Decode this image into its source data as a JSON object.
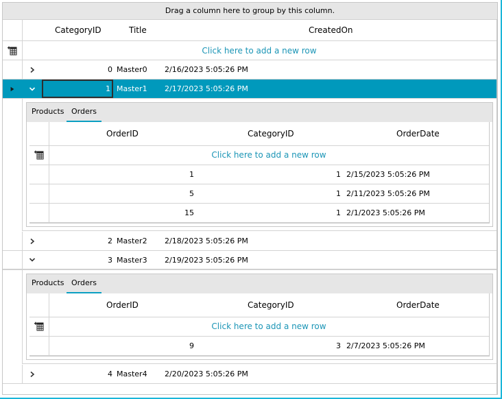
{
  "group_panel": {
    "text": "Drag a column here to group by this column."
  },
  "colors": {
    "accent": "#0099bc",
    "link": "#1b95b6",
    "tab_underline": "#0a9fc2",
    "frame_edge": "#1ab6d9"
  },
  "master": {
    "columns": [
      "CategoryID",
      "Title",
      "CreatedOn"
    ],
    "new_row_text": "Click here to add a new row",
    "rows": [
      {
        "id": "0",
        "title": "Master0",
        "created": "2/16/2023 5:05:26 PM",
        "expanded": false,
        "selected": false
      },
      {
        "id": "1",
        "title": "Master1",
        "created": "2/17/2023 5:05:26 PM",
        "expanded": true,
        "selected": true
      },
      {
        "id": "2",
        "title": "Master2",
        "created": "2/18/2023 5:05:26 PM",
        "expanded": false,
        "selected": false
      },
      {
        "id": "3",
        "title": "Master3",
        "created": "2/19/2023 5:05:26 PM",
        "expanded": true,
        "selected": false
      },
      {
        "id": "4",
        "title": "Master4",
        "created": "2/20/2023 5:05:26 PM",
        "expanded": false,
        "selected": false
      }
    ]
  },
  "details": [
    {
      "tabs": [
        "Products",
        "Orders"
      ],
      "active_tab": "Orders",
      "columns": [
        "OrderID",
        "CategoryID",
        "OrderDate"
      ],
      "new_row_text": "Click here to add a new row",
      "rows": [
        {
          "order_id": "1",
          "category_id": "1",
          "order_date": "2/15/2023 5:05:26 PM"
        },
        {
          "order_id": "5",
          "category_id": "1",
          "order_date": "2/11/2023 5:05:26 PM"
        },
        {
          "order_id": "15",
          "category_id": "1",
          "order_date": "2/1/2023 5:05:26 PM"
        }
      ]
    },
    {
      "tabs": [
        "Products",
        "Orders"
      ],
      "active_tab": "Orders",
      "columns": [
        "OrderID",
        "CategoryID",
        "OrderDate"
      ],
      "new_row_text": "Click here to add a new row",
      "rows": [
        {
          "order_id": "9",
          "category_id": "3",
          "order_date": "2/7/2023 5:05:26 PM"
        }
      ]
    }
  ],
  "icons": {
    "add_row": "add-new-row-icon",
    "expand": "chevron-right-icon",
    "collapse": "chevron-down-icon",
    "current_row": "current-row-indicator-icon"
  }
}
